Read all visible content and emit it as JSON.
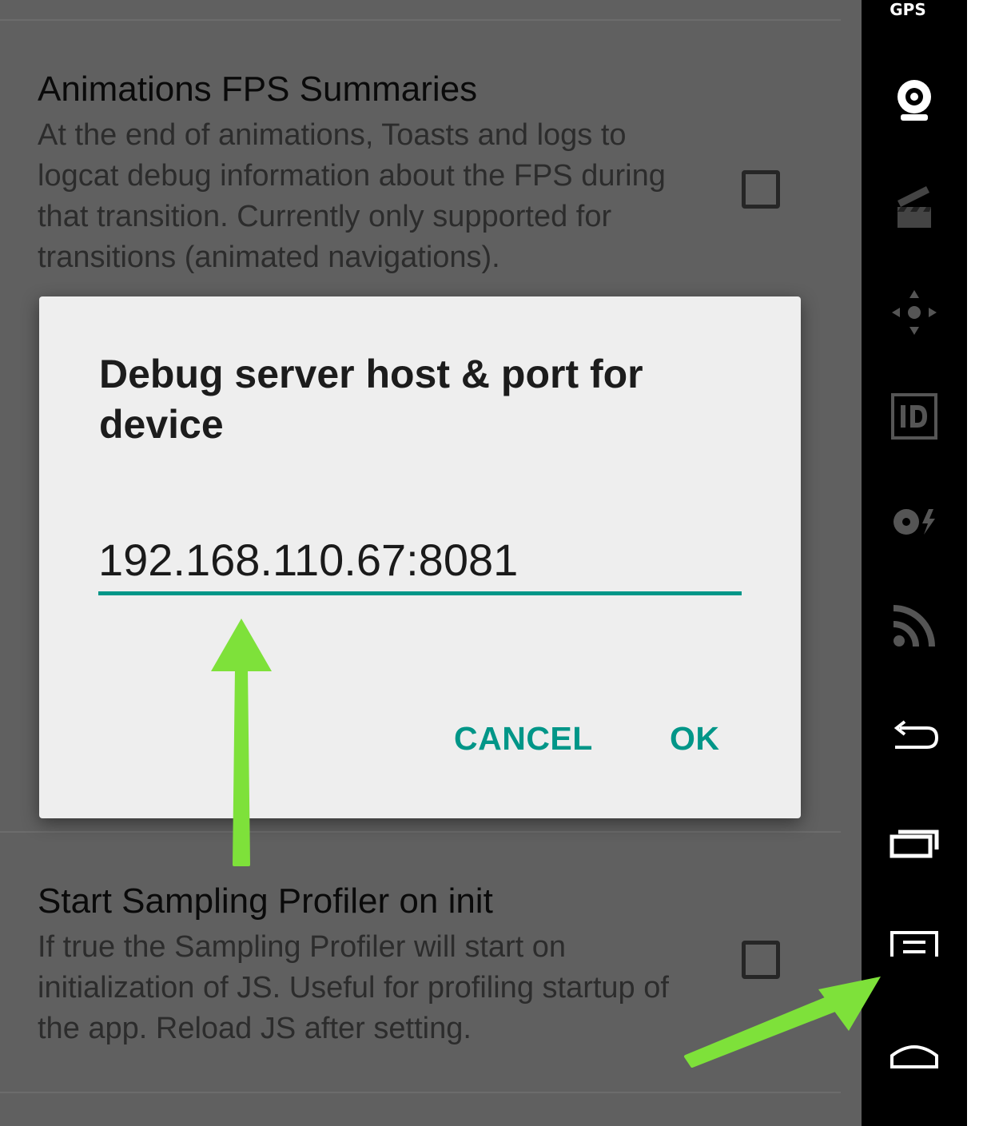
{
  "settings": {
    "items": [
      {
        "title": "Animations FPS Summaries",
        "summary": "At the end of animations, Toasts and logs to logcat debug information about the FPS during that transition. Currently only supported for transitions (animated navigations).",
        "checked": false
      },
      {
        "title": "Start Sampling Profiler on init",
        "summary": "If true the Sampling Profiler will start on initialization of JS. Useful for profiling startup of the app. Reload JS after setting.",
        "checked": false
      }
    ]
  },
  "dialog": {
    "title": "Debug server host & port for device",
    "input_value": "192.168.110.67:8081",
    "cancel_label": "CANCEL",
    "ok_label": "OK"
  },
  "sidebar": {
    "gps_label": "GPS",
    "buttons": [
      "camera-icon",
      "clapperboard-icon",
      "dpad-icon",
      "id-icon",
      "battery-icon",
      "wifi-signal-icon",
      "back-icon",
      "recent-apps-icon",
      "menu-icon",
      "home-icon"
    ]
  },
  "colors": {
    "accent": "#009688",
    "annotation_arrow": "#7ee13a",
    "sidebar_bg": "#000000",
    "dim_background": "#606060"
  }
}
